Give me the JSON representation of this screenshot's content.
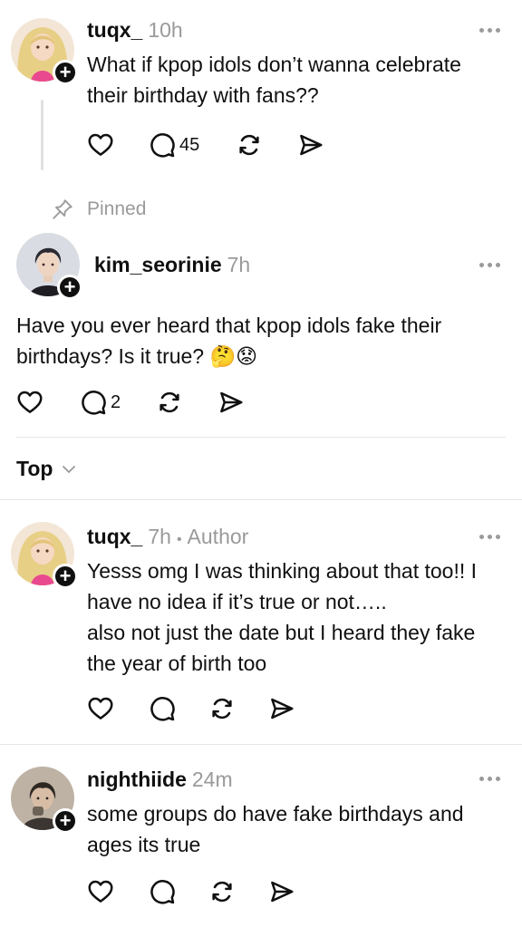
{
  "thread_root": {
    "username": "tuqx_",
    "time": "10h",
    "text_lines": [
      "What if kpop idols don’t wanna celebrate",
      "their birthday with fans??"
    ],
    "reply_count": "45"
  },
  "pinned_label": "Pinned",
  "pinned_post": {
    "username": "kim_seorinie",
    "time": "7h",
    "text_lines": [
      "Have you ever heard that kpop idols fake their",
      "birthdays? Is it true? 🤔😟"
    ],
    "reply_count": "2"
  },
  "sort": {
    "label": "Top"
  },
  "replies": [
    {
      "username": "tuqx_",
      "time": "7h",
      "separator": "•",
      "badge": "Author",
      "text_lines": [
        "Yesss omg I was thinking about that too!! I",
        "have no idea if it’s true or not…..",
        "also not just the date but I heard they fake",
        "the year of birth too"
      ]
    },
    {
      "username": "nighthiide",
      "time": "24m",
      "text_lines": [
        "some groups do have fake birthdays and",
        "ages its true"
      ]
    }
  ],
  "icons": {
    "like": "heart-icon",
    "reply": "comment-icon",
    "repost": "repost-icon",
    "share": "send-icon",
    "more": "more-dots-icon",
    "pin": "pin-icon",
    "sort": "chevron-down-icon",
    "follow": "plus-icon"
  },
  "colors": {
    "text": "#101010",
    "muted": "#9a9a9a",
    "divider": "#e6e6e6"
  }
}
